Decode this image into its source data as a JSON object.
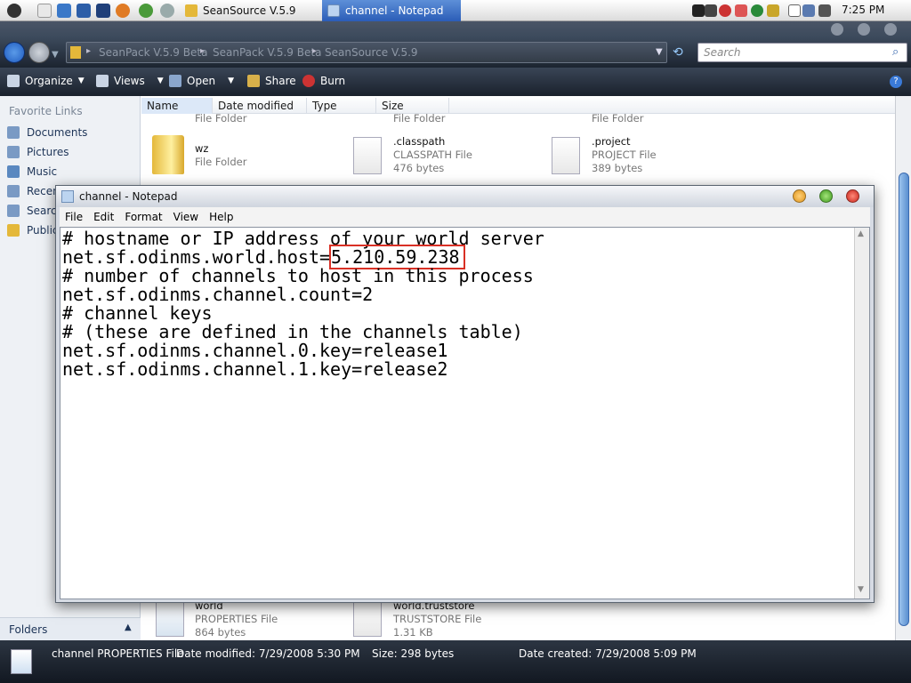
{
  "taskbar": {
    "tasks": [
      {
        "label": "SeanSource V.5.9",
        "icon": "folder-icon"
      },
      {
        "label": "channel - Notepad",
        "icon": "notepad-icon",
        "active": true
      }
    ],
    "clock": "7:25 PM"
  },
  "explorer": {
    "breadcrumb": [
      "SeanPack V.5.9 Beta",
      "SeanPack V.5.9 Beta",
      "SeanSource V.5.9"
    ],
    "search_placeholder": "Search",
    "toolbar": {
      "organize": "Organize",
      "views": "Views",
      "open": "Open",
      "share": "Share",
      "burn": "Burn"
    },
    "nav": {
      "heading": "Favorite Links",
      "items": [
        "Documents",
        "Pictures",
        "Music",
        "Recen",
        "Search",
        "Public"
      ],
      "folders": "Folders"
    },
    "columns": [
      "Name",
      "Date modified",
      "Type",
      "Size"
    ],
    "files_top": [
      {
        "name": "",
        "type": "File Folder"
      },
      {
        "name": "",
        "type": "File Folder"
      },
      {
        "name": "",
        "type": "File Folder"
      }
    ],
    "files": [
      {
        "name": "wz",
        "type": "File Folder",
        "size": ""
      },
      {
        "name": ".classpath",
        "type": "CLASSPATH File",
        "size": "476 bytes"
      },
      {
        "name": ".project",
        "type": "PROJECT File",
        "size": "389 bytes"
      }
    ],
    "files_bottom": [
      {
        "name": "world",
        "type": "PROPERTIES File",
        "size": "864 bytes"
      },
      {
        "name": "world.truststore",
        "type": "TRUSTSTORE File",
        "size": "1.31 KB"
      }
    ],
    "status": {
      "name": "channel PROPERTIES File",
      "modified": "Date modified: 7/29/2008 5:30 PM",
      "size": "Size: 298 bytes",
      "created": "Date created: 7/29/2008 5:09 PM"
    }
  },
  "notepad": {
    "title": "channel - Notepad",
    "menu": [
      "File",
      "Edit",
      "Format",
      "View",
      "Help"
    ],
    "lines": [
      "# hostname or IP address of your world server",
      "net.sf.odinms.world.host=",
      "# number of channels to host in this process",
      "net.sf.odinms.channel.count=2",
      "# channel keys",
      "# (these are defined in the channels table)",
      "net.sf.odinms.channel.0.key=release1",
      "net.sf.odinms.channel.1.key=release2"
    ],
    "highlight_ip": "5.210.59.238",
    "highlight_color": "#d93025"
  }
}
